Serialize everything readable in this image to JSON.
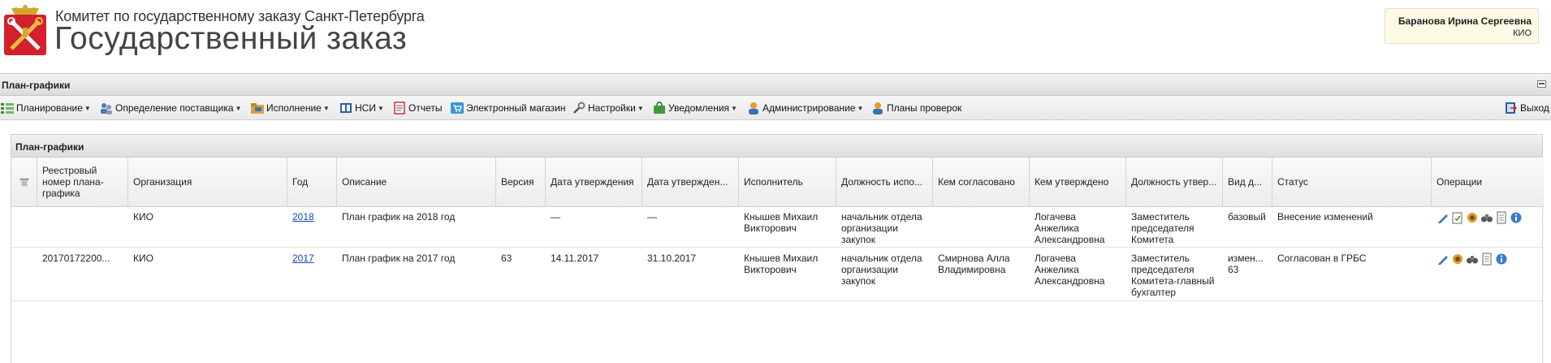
{
  "header": {
    "org_name": "Комитет по государственному заказу Санкт-Петербурга",
    "app_title": "Государственный заказ",
    "user_name": "Баранова Ирина Сергеевна",
    "user_role": "КИО"
  },
  "panel": {
    "title": "План-графики"
  },
  "toolbar": {
    "planning": "Планирование",
    "supplier": "Определение поставщика",
    "execution": "Исполнение",
    "nsi": "НСИ",
    "reports": "Отчеты",
    "eshop": "Электронный магазин",
    "settings": "Настройки",
    "notifications": "Уведомления",
    "admin": "Администрирование",
    "inspections": "Планы проверок",
    "exit": "Выход"
  },
  "grid": {
    "title": "План-графики",
    "columns": [
      "Реестровый номер плана-графика",
      "Организация",
      "Год",
      "Описание",
      "Версия",
      "Дата утверждения",
      "Дата утвержден...",
      "Исполнитель",
      "Должность испо...",
      "Кем согласовано",
      "Кем утверждено",
      "Должность утвер...",
      "Вид д...",
      "Статус",
      "Операции"
    ],
    "rows": [
      {
        "reg_number": "",
        "org": "КИО",
        "year": "2018",
        "description": "План график на 2018 год",
        "version": "",
        "approval_date": "—",
        "approval_date2": "—",
        "executor": "Кнышев Михаил Викторович",
        "executor_position": "начальник отдела организации закупок",
        "agreed_by": "",
        "approved_by": "Логачева Анжелика Александровна",
        "approver_position": "Заместитель председателя Комитета",
        "doc_type": "базовый",
        "status": "Внесение изменений"
      },
      {
        "reg_number": "20170172200...",
        "org": "КИО",
        "year": "2017",
        "description": "План график на 2017 год",
        "version": "63",
        "approval_date": "14.11.2017",
        "approval_date2": "31.10.2017",
        "executor": "Кнышев Михаил Викторович",
        "executor_position": "начальник отдела организации закупок",
        "agreed_by": "Смирнова Алла Владимировна",
        "approved_by": "Логачева Анжелика Александровна",
        "approver_position": "Заместитель председателя Комитета-главный бухгалтер",
        "doc_type": "измен... 63",
        "status": "Согласован в ГРБС"
      }
    ]
  },
  "colors": {
    "logo_red": "#d4202c",
    "link": "#1a44b8",
    "user_box_bg": "#fdfbe6"
  },
  "icons": {
    "logo": "spb-coat-of-arms-icon",
    "grid_corner": "settings-wrench-icon",
    "operations": [
      "edit-pencil-icon",
      "document-check-icon",
      "emblem-icon",
      "binoculars-icon",
      "document-icon",
      "info-icon"
    ]
  }
}
